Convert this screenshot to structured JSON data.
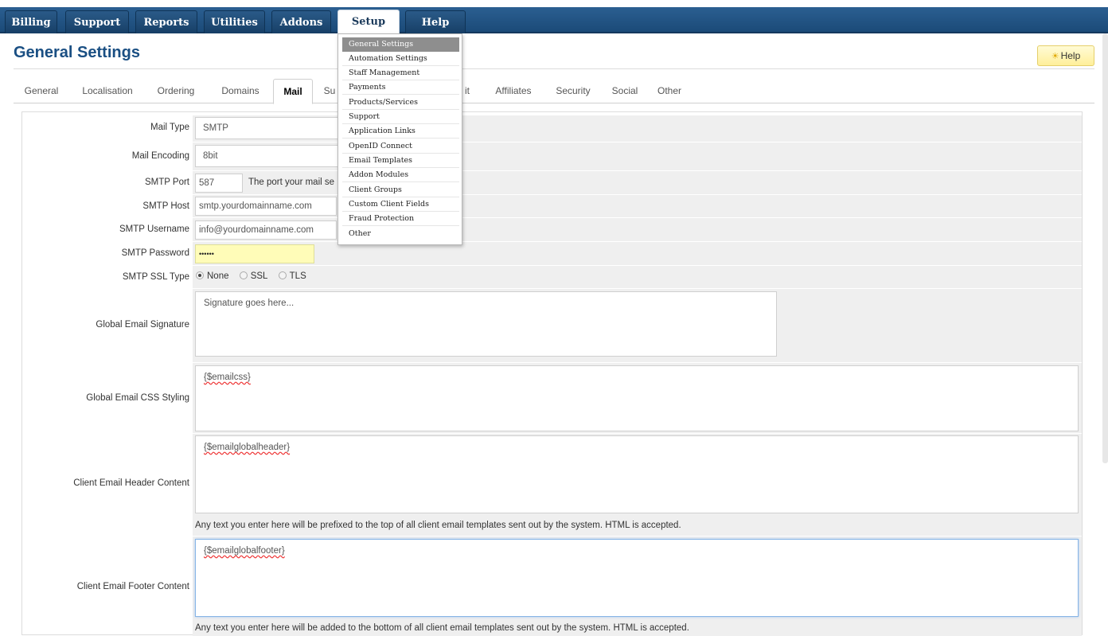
{
  "nav": {
    "items": [
      "Billing",
      "Support",
      "Reports",
      "Utilities",
      "Addons",
      "Setup",
      "Help"
    ],
    "active": "Setup"
  },
  "page": {
    "title": "General Settings",
    "help_label": "Help"
  },
  "tabs": {
    "items": [
      "General",
      "Localisation",
      "Ordering",
      "Domains",
      "Mail",
      "Su",
      "it",
      "Affiliates",
      "Security",
      "Social",
      "Other"
    ],
    "active": "Mail"
  },
  "setup_menu": {
    "items": [
      "General Settings",
      "Automation Settings",
      "Staff Management",
      "Payments",
      "Products/Services",
      "Support",
      "Application Links",
      "OpenID Connect",
      "Email Templates",
      "Addon Modules",
      "Client Groups",
      "Custom Client Fields",
      "Fraud Protection",
      "Other"
    ],
    "selected": "General Settings"
  },
  "form": {
    "mail_type": {
      "label": "Mail Type",
      "value": "SMTP"
    },
    "mail_encoding": {
      "label": "Mail Encoding",
      "value": "8bit"
    },
    "smtp_port": {
      "label": "SMTP Port",
      "value": "587",
      "help": "The port your mail se"
    },
    "smtp_host": {
      "label": "SMTP Host",
      "placeholder": "smtp.yourdomainname.com"
    },
    "smtp_username": {
      "label": "SMTP Username",
      "placeholder": "info@yourdomainname.com"
    },
    "smtp_password": {
      "label": "SMTP Password",
      "value": "••••••"
    },
    "smtp_ssl_type": {
      "label": "SMTP SSL Type",
      "options": [
        "None",
        "SSL",
        "TLS"
      ],
      "selected": "None"
    },
    "global_signature": {
      "label": "Global Email Signature",
      "placeholder": "Signature goes here..."
    },
    "global_css": {
      "label": "Global Email CSS Styling",
      "value": "{$emailcss}"
    },
    "header_content": {
      "label": "Client Email Header Content",
      "value": "{$emailglobalheader}",
      "help": "Any text you enter here will be prefixed to the top of all client email templates sent out by the system. HTML is accepted."
    },
    "footer_content": {
      "label": "Client Email Footer Content",
      "value": "{$emailglobalfooter}",
      "help": "Any text you enter here will be added to the bottom of all client email templates sent out by the system. HTML is accepted."
    }
  }
}
